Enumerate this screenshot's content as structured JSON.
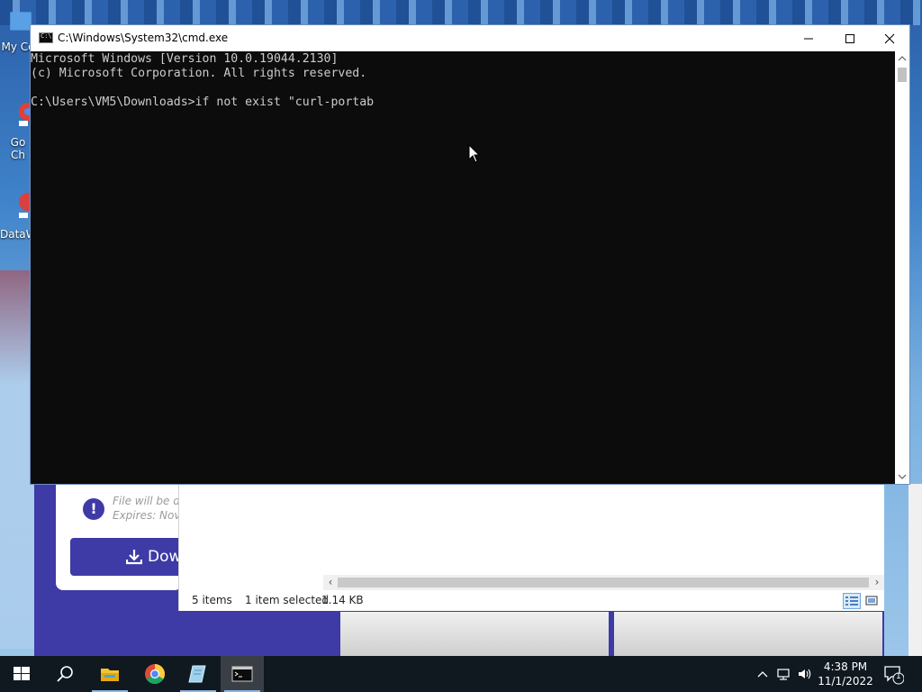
{
  "desktop": {
    "icons": [
      {
        "label": "My Co"
      },
      {
        "label": "Go\nCh"
      },
      {
        "label": "DataW"
      }
    ]
  },
  "browser": {
    "notice_line1": "File will be de",
    "notice_line2": "Expires: Nov",
    "download_label": "Dow"
  },
  "explorer": {
    "item_count": "5 items",
    "selection": "1 item selected",
    "selection_size": "1.14 KB"
  },
  "cmd": {
    "title": "C:\\Windows\\System32\\cmd.exe",
    "lines": [
      "Microsoft Windows [Version 10.0.19044.2130]",
      "(c) Microsoft Corporation. All rights reserved.",
      "",
      "C:\\Users\\VM5\\Downloads>if not exist \"curl-portab"
    ],
    "colors": {
      "background": "#0c0c0c",
      "text": "#cccccc"
    }
  },
  "taskbar": {
    "items": [
      "start-icon",
      "search-icon",
      "file-explorer-icon",
      "chrome-icon",
      "notepad-icon",
      "cmd-icon"
    ],
    "clock_time": "4:38 PM",
    "clock_date": "11/1/2022",
    "notification_count": "1"
  }
}
